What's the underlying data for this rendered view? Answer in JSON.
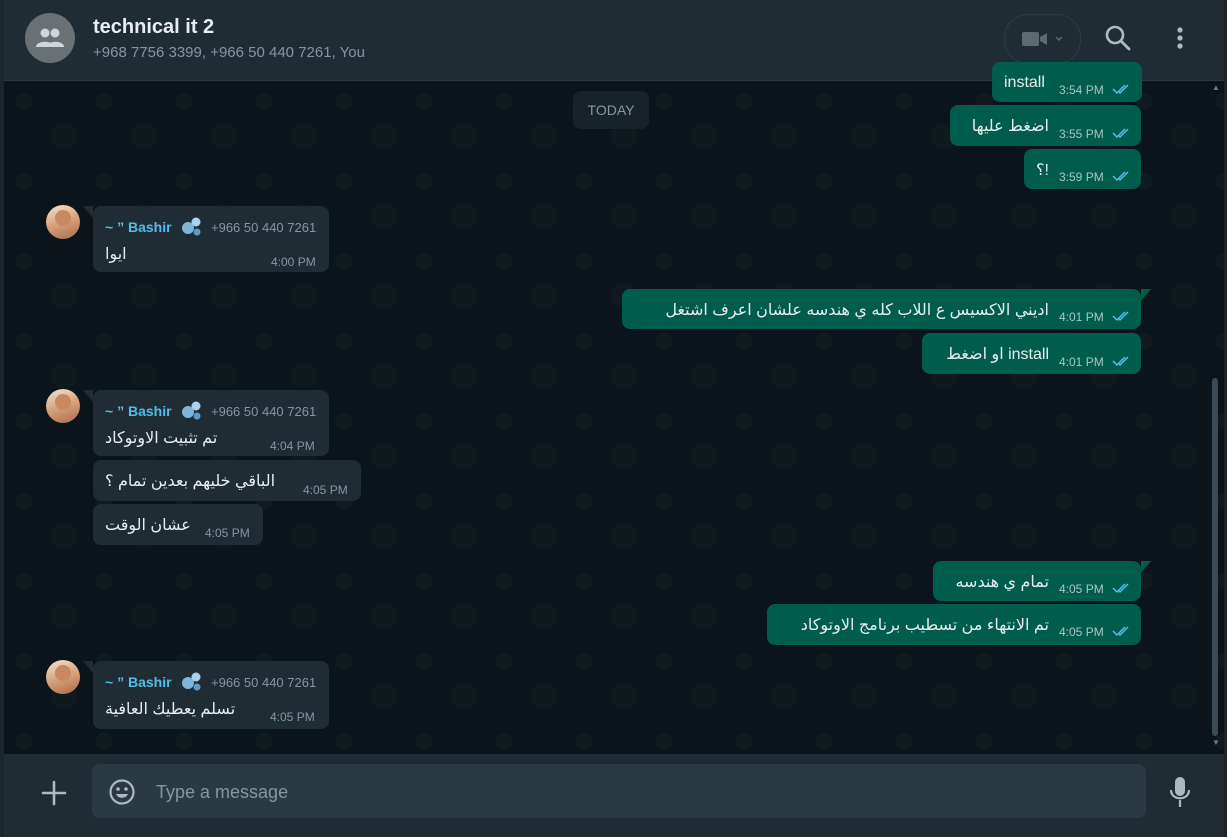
{
  "header": {
    "title": "technical it 2",
    "subtitle": "+968 7756 3399, +966 50 440 7261, You",
    "icons": [
      "group-avatar-icon",
      "video-call-icon",
      "chevron-down-icon",
      "search-icon",
      "menu-icon"
    ]
  },
  "date_divider": "TODAY",
  "messages": [
    {
      "direction": "out",
      "text": "install",
      "time": "3:54 PM",
      "status": "read"
    },
    {
      "direction": "out",
      "text": "اضغط عليها",
      "time": "3:55 PM",
      "status": "read"
    },
    {
      "direction": "out",
      "text": "؟!",
      "time": "3:59 PM",
      "status": "read"
    },
    {
      "direction": "in",
      "sender": "~ ” Bashir",
      "phone": "+966 50 440 7261",
      "text": "ايوا",
      "time": "4:00 PM"
    },
    {
      "direction": "out",
      "text": "اديني الاكسيس ع اللاب كله ي هندسه علشان اعرف اشتغل",
      "time": "4:01 PM",
      "status": "read"
    },
    {
      "direction": "out",
      "text": "او اضغط install",
      "time": "4:01 PM",
      "status": "read"
    },
    {
      "direction": "in",
      "sender": "~ ” Bashir",
      "phone": "+966 50 440 7261",
      "text": "تم تثبيت الاوتوكاد",
      "time": "4:04 PM"
    },
    {
      "direction": "in",
      "text": "الباقي خليهم بعدين تمام ؟",
      "time": "4:05 PM"
    },
    {
      "direction": "in",
      "text": "عشان الوقت",
      "time": "4:05 PM"
    },
    {
      "direction": "out",
      "text": "تمام ي هندسه",
      "time": "4:05 PM",
      "status": "read"
    },
    {
      "direction": "out",
      "text": "تم الانتهاء من تسطيب برنامج الاوتوكاد",
      "time": "4:05 PM",
      "status": "read"
    },
    {
      "direction": "in",
      "sender": "~ ” Bashir",
      "phone": "+966 50 440 7261",
      "text": "تسلم يعطيك العافية",
      "time": "4:05 PM"
    }
  ],
  "composer": {
    "placeholder": "Type a message",
    "icons": [
      "plus-icon",
      "emoji-icon",
      "microphone-icon"
    ]
  },
  "colors": {
    "outgoing_bubble": "#005c4b",
    "incoming_bubble": "#202c33",
    "sender_name": "#53bdeb",
    "read_ticks": "#53bdeb"
  }
}
